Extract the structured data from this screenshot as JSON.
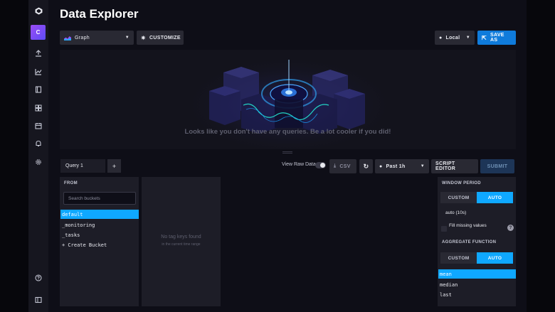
{
  "app": {
    "title": "Data Explorer",
    "org_initial": "C"
  },
  "toolbar": {
    "graph_type": "Graph",
    "customize_label": "CUSTOMIZE",
    "timezone": "Local",
    "save_as_label": "SAVE AS"
  },
  "graph": {
    "empty_message": "Looks like you don't have any queries. Be a lot cooler if you did!"
  },
  "query_bar": {
    "query_tab": "Query 1",
    "add_label": "+",
    "raw_data_label": "View Raw Data",
    "csv_label": "CSV",
    "time_range": "Past 1h",
    "script_editor_label": "SCRIPT EDITOR",
    "submit_label": "SUBMIT"
  },
  "from_panel": {
    "header": "FROM",
    "search_placeholder": "Search buckets",
    "buckets": [
      "default",
      "_monitoring",
      "_tasks",
      "+ Create Bucket"
    ],
    "selected_bucket": "default"
  },
  "tag_panel": {
    "empty_title": "No tag keys found",
    "empty_subtitle": "in the current time range"
  },
  "window_panel": {
    "header": "WINDOW PERIOD",
    "custom_label": "CUSTOM",
    "auto_label": "AUTO",
    "auto_value": "auto (10s)",
    "fill_missing_label": "Fill missing values",
    "help_label": "?",
    "aggregate_header": "AGGREGATE FUNCTION",
    "agg_custom_label": "CUSTOM",
    "agg_auto_label": "AUTO",
    "functions": [
      "mean",
      "median",
      "last"
    ],
    "selected_function": "mean"
  },
  "colors": {
    "accent": "#0fa8ff",
    "save_button": "#0f7bdb",
    "org_badge": "#9b4cf5"
  }
}
